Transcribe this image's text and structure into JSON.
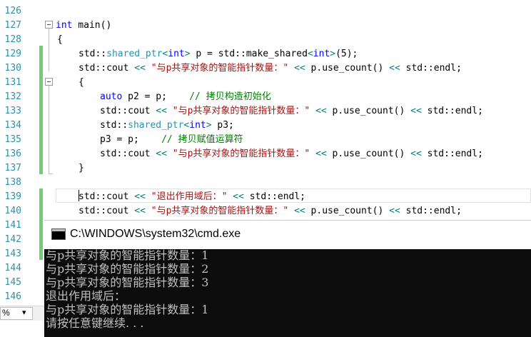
{
  "editor": {
    "line_numbers": [
      "126",
      "127",
      "128",
      "129",
      "130",
      "131",
      "132",
      "133",
      "134",
      "135",
      "136",
      "137",
      "138",
      "139",
      "140",
      "141",
      "142",
      "143",
      "144",
      "145",
      "146"
    ],
    "lines": [
      {
        "ln": "127",
        "segs": [
          {
            "t": "int",
            "c": "kw"
          },
          {
            "t": " main()",
            "c": ""
          }
        ]
      },
      {
        "ln": "128",
        "segs": [
          {
            "t": "{",
            "c": ""
          }
        ]
      },
      {
        "ln": "129",
        "segs": [
          {
            "t": "std::",
            "c": ""
          },
          {
            "t": "shared_ptr",
            "c": "ty"
          },
          {
            "t": "<",
            "c": "op"
          },
          {
            "t": "int",
            "c": "kw"
          },
          {
            "t": ">",
            "c": "op"
          },
          {
            "t": " p = std::make_shared",
            "c": ""
          },
          {
            "t": "<",
            "c": "op"
          },
          {
            "t": "int",
            "c": "kw"
          },
          {
            "t": ">",
            "c": "op"
          },
          {
            "t": "(5);",
            "c": ""
          }
        ]
      },
      {
        "ln": "130",
        "segs": [
          {
            "t": "std::cout ",
            "c": ""
          },
          {
            "t": "<<",
            "c": "op"
          },
          {
            "t": " \"与p共享对象的智能指针数量：\" ",
            "c": "str"
          },
          {
            "t": "<<",
            "c": "op"
          },
          {
            "t": " p.use_count() ",
            "c": ""
          },
          {
            "t": "<<",
            "c": "op"
          },
          {
            "t": " std::endl;",
            "c": ""
          }
        ]
      },
      {
        "ln": "131",
        "segs": [
          {
            "t": "{",
            "c": ""
          }
        ]
      },
      {
        "ln": "132",
        "segs": [
          {
            "t": "auto",
            "c": "kw"
          },
          {
            "t": " p2 = p;    ",
            "c": ""
          },
          {
            "t": "// 拷贝构造初始化",
            "c": "cm"
          }
        ]
      },
      {
        "ln": "133",
        "segs": [
          {
            "t": "std::cout ",
            "c": ""
          },
          {
            "t": "<<",
            "c": "op"
          },
          {
            "t": " \"与p共享对象的智能指针数量：\" ",
            "c": "str"
          },
          {
            "t": "<<",
            "c": "op"
          },
          {
            "t": " p.use_count() ",
            "c": ""
          },
          {
            "t": "<<",
            "c": "op"
          },
          {
            "t": " std::endl;",
            "c": ""
          }
        ]
      },
      {
        "ln": "134",
        "segs": [
          {
            "t": "std::",
            "c": ""
          },
          {
            "t": "shared_ptr",
            "c": "ty"
          },
          {
            "t": "<",
            "c": "op"
          },
          {
            "t": "int",
            "c": "kw"
          },
          {
            "t": ">",
            "c": "op"
          },
          {
            "t": " p3;",
            "c": ""
          }
        ]
      },
      {
        "ln": "135",
        "segs": [
          {
            "t": "p3 = p;    ",
            "c": ""
          },
          {
            "t": "// 拷贝赋值运算符",
            "c": "cm"
          }
        ]
      },
      {
        "ln": "136",
        "segs": [
          {
            "t": "std::cout ",
            "c": ""
          },
          {
            "t": "<<",
            "c": "op"
          },
          {
            "t": " \"与p共享对象的智能指针数量：\" ",
            "c": "str"
          },
          {
            "t": "<<",
            "c": "op"
          },
          {
            "t": " p.use_count() ",
            "c": ""
          },
          {
            "t": "<<",
            "c": "op"
          },
          {
            "t": " std::endl;",
            "c": ""
          }
        ]
      },
      {
        "ln": "137",
        "segs": [
          {
            "t": "}",
            "c": ""
          }
        ]
      },
      {
        "ln": "139",
        "segs": [
          {
            "t": "std::cout ",
            "c": ""
          },
          {
            "t": "<<",
            "c": "op"
          },
          {
            "t": " \"退出作用域后：\" ",
            "c": "str"
          },
          {
            "t": "<<",
            "c": "op"
          },
          {
            "t": " std::endl;",
            "c": ""
          }
        ]
      },
      {
        "ln": "140",
        "segs": [
          {
            "t": "std::cout ",
            "c": ""
          },
          {
            "t": "<<",
            "c": "op"
          },
          {
            "t": " \"与p共享对象的智能指针数量：\" ",
            "c": "str"
          },
          {
            "t": "<<",
            "c": "op"
          },
          {
            "t": " p.use_count() ",
            "c": ""
          },
          {
            "t": "<<",
            "c": "op"
          },
          {
            "t": " std::endl;",
            "c": ""
          }
        ]
      }
    ]
  },
  "statusbar": {
    "zoom": "%",
    "zoom_arrow": "▾"
  },
  "console": {
    "title": "C:\\WINDOWS\\system32\\cmd.exe",
    "output": [
      "与p共享对象的智能指针数量：1",
      "与p共享对象的智能指针数量：2",
      "与p共享对象的智能指针数量：3",
      "退出作用域后：",
      "与p共享对象的智能指针数量：1",
      "请按任意键继续. . ."
    ]
  }
}
